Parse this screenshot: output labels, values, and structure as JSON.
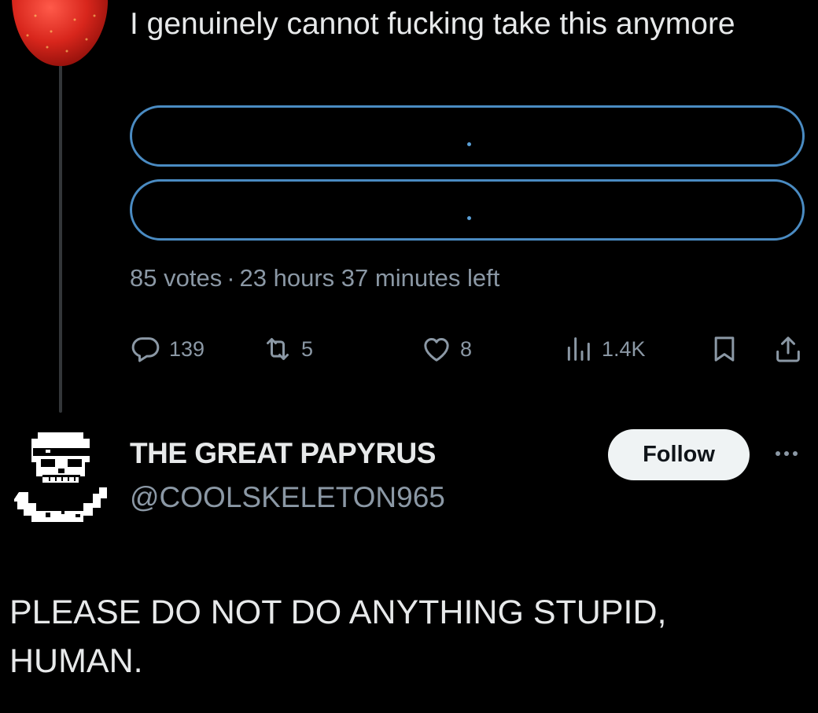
{
  "tweet": {
    "text": "I genuinely cannot fucking take this anymore",
    "poll": {
      "options": [
        "",
        ""
      ],
      "votes": "85 votes",
      "separator": "·",
      "time_left": "23 hours 37 minutes left"
    },
    "actions": {
      "replies": "139",
      "reposts": "5",
      "likes": "8",
      "views": "1.4K"
    }
  },
  "reply": {
    "display_name": "THE GREAT PAPYRUS",
    "handle": "@COOLSKELETON965",
    "follow_label": "Follow",
    "text": "PLEASE DO NOT DO ANYTHING STUPID, HUMAN."
  },
  "icons": {
    "reply": "reply-icon",
    "repost": "repost-icon",
    "like": "heart-icon",
    "views": "views-icon",
    "bookmark": "bookmark-icon",
    "share": "share-icon",
    "more": "more-dots-icon"
  },
  "colors": {
    "background": "#000000",
    "text": "#e7e9ea",
    "muted": "#8b98a5",
    "poll_border": "#4a8bc2",
    "follow_bg": "#eff3f4"
  }
}
